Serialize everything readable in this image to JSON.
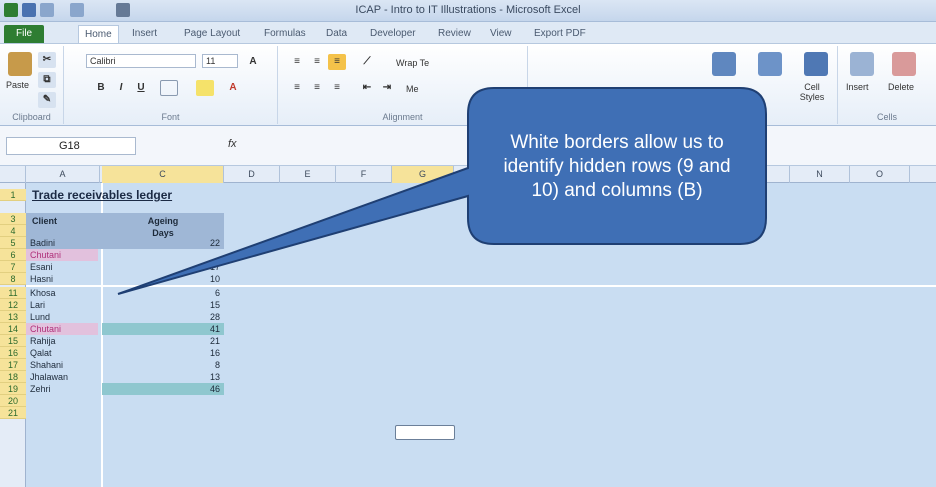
{
  "window": {
    "title": "ICAP - Intro to IT Illustrations - Microsoft Excel"
  },
  "tabs": [
    {
      "label": "File"
    },
    {
      "label": "Home"
    },
    {
      "label": "Insert"
    },
    {
      "label": "Page Layout"
    },
    {
      "label": "Formulas"
    },
    {
      "label": "Data"
    },
    {
      "label": "Developer"
    },
    {
      "label": "Review"
    },
    {
      "label": "View"
    },
    {
      "label": "Export PDF"
    }
  ],
  "ribbon": {
    "paste_label": "Paste",
    "font_name": "Calibri",
    "font_size": "11",
    "wrap_text": "Wrap Te",
    "merge_label": "Me",
    "cell_styles": "Cell Styles",
    "insert": "Insert",
    "delete": "Delete",
    "groups": {
      "clipboard": "Clipboard",
      "font": "Font",
      "alignment": "Alignment",
      "cells": "Cells"
    }
  },
  "formula_bar": {
    "name_box": "G18",
    "fx": "fx"
  },
  "columns": [
    "A",
    "C",
    "D",
    "E",
    "F",
    "G",
    "N",
    "O"
  ],
  "sheet": {
    "title": "Trade receivables ledger",
    "header_client": "Client",
    "header_ageing": "Ageing",
    "header_days": "Days",
    "rows": [
      {
        "row": "5",
        "client": "Badini",
        "days": "22",
        "style": "normal"
      },
      {
        "row": "6",
        "client": "Chutani",
        "days": "",
        "style": "pink"
      },
      {
        "row": "7",
        "client": "Esani",
        "days": "17",
        "style": "normal"
      },
      {
        "row": "8",
        "client": "Hasni",
        "days": "10",
        "style": "normal"
      },
      {
        "row": "11",
        "client": "Khosa",
        "days": "6",
        "style": "normal"
      },
      {
        "row": "12",
        "client": "Lari",
        "days": "15",
        "style": "normal"
      },
      {
        "row": "13",
        "client": "Lund",
        "days": "28",
        "style": "normal"
      },
      {
        "row": "14",
        "client": "Chutani",
        "days": "41",
        "style": "pink-teal"
      },
      {
        "row": "15",
        "client": "Rahija",
        "days": "21",
        "style": "normal"
      },
      {
        "row": "16",
        "client": "Qalat",
        "days": "16",
        "style": "normal"
      },
      {
        "row": "17",
        "client": "Shahani",
        "days": "8",
        "style": "normal"
      },
      {
        "row": "18",
        "client": "Jhalawan",
        "days": "13",
        "style": "normal"
      },
      {
        "row": "19",
        "client": "Zehri",
        "days": "46",
        "style": "teal"
      }
    ],
    "top_rows": [
      "1",
      "3",
      "4"
    ],
    "bottom_rows": [
      "20",
      "21"
    ]
  },
  "callout": {
    "text": "White borders allow us to identify hidden rows (9 and 10) and columns (B)",
    "fill": "#3f6fb5",
    "stroke": "#1f3f73"
  }
}
